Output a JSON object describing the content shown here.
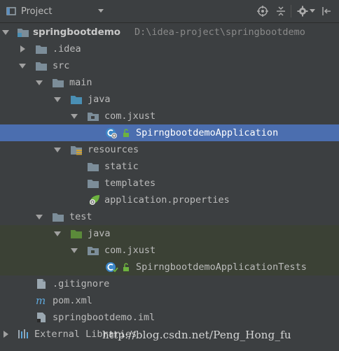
{
  "panel": {
    "title": "Project",
    "colors": {
      "background": "#3c3f41",
      "selection": "#4b6eaf",
      "test_band": "#3b4135",
      "folder": "#7c8d99",
      "source_folder": "#4a8fb4",
      "test_source_folder": "#5b8a3a",
      "spring_green": "#6db33f"
    }
  },
  "toolbar_icons": [
    "project-dropdown-icon",
    "locate-icon",
    "collapse-all-icon",
    "settings-icon",
    "hide-panel-icon"
  ],
  "tree": {
    "items": [
      {
        "label": "springbootdemo",
        "path": "D:\\idea-project\\springbootdemo",
        "icon": "module-folder-icon",
        "expanded": true
      },
      {
        "label": ".idea",
        "icon": "folder-icon",
        "expanded": false
      },
      {
        "label": "src",
        "icon": "folder-icon",
        "expanded": true
      },
      {
        "label": "main",
        "icon": "folder-icon",
        "expanded": true
      },
      {
        "label": "java",
        "icon": "source-folder-icon",
        "expanded": true
      },
      {
        "label": "com.jxust",
        "icon": "package-icon",
        "expanded": true
      },
      {
        "label": "SpirngbootdemoApplication",
        "icon": "spring-boot-class-icon",
        "selected": true
      },
      {
        "label": "resources",
        "icon": "resources-folder-icon",
        "expanded": true
      },
      {
        "label": "static",
        "icon": "folder-icon"
      },
      {
        "label": "templates",
        "icon": "folder-icon"
      },
      {
        "label": "application.properties",
        "icon": "spring-properties-icon"
      },
      {
        "label": "test",
        "icon": "folder-icon",
        "expanded": true
      },
      {
        "label": "java",
        "icon": "test-source-folder-icon",
        "expanded": true
      },
      {
        "label": "com.jxust",
        "icon": "package-icon",
        "expanded": true
      },
      {
        "label": "SpirngbootdemoApplicationTests",
        "icon": "test-class-icon"
      },
      {
        "label": ".gitignore",
        "icon": "file-icon"
      },
      {
        "label": "pom.xml",
        "icon": "maven-icon"
      },
      {
        "label": "springbootdemo.iml",
        "icon": "iml-file-icon"
      },
      {
        "label": "External Libraries",
        "icon": "libraries-icon",
        "expanded": false
      }
    ]
  },
  "watermark": "http://blog.csdn.net/Peng_Hong_fu"
}
